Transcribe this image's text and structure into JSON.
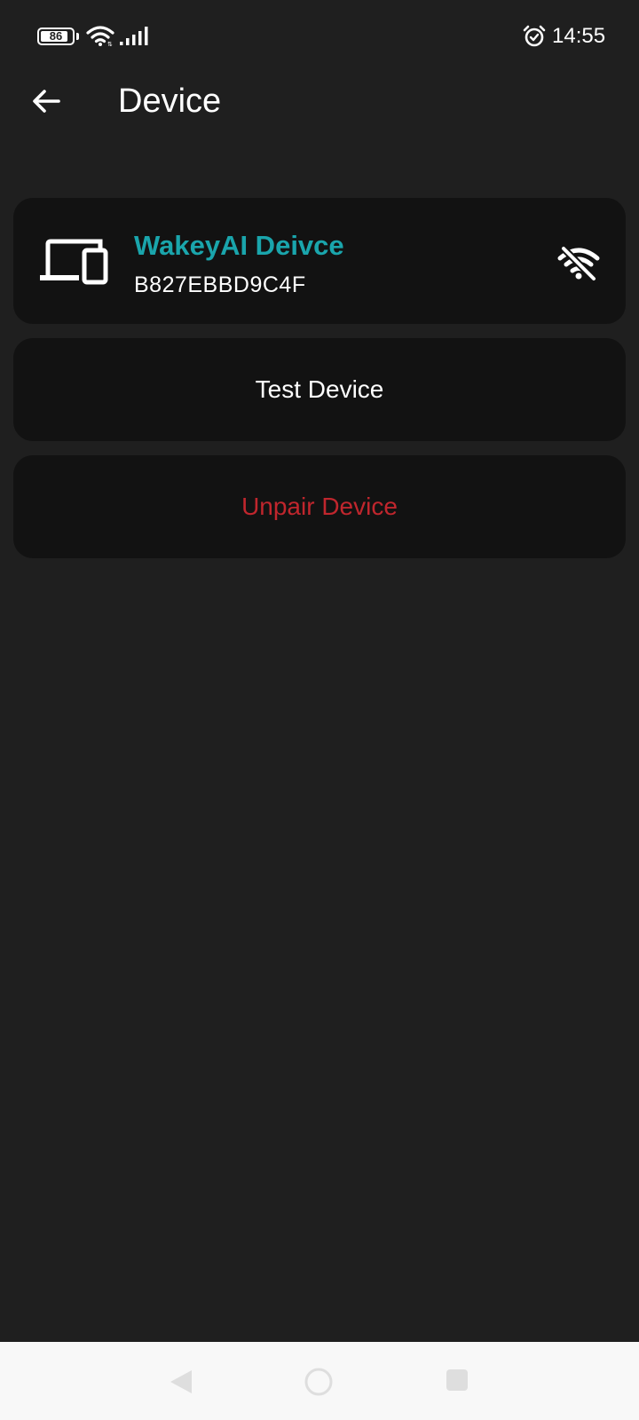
{
  "status_bar": {
    "battery_level": "86",
    "time": "14:55",
    "icons": [
      "battery-icon",
      "wifi-icon",
      "cellular-signal-icon",
      "alarm-icon"
    ]
  },
  "app_bar": {
    "title": "Device",
    "back_icon": "arrow-left-icon"
  },
  "device": {
    "name": "WakeyAI Deivce",
    "id": "B827EBBD9C4F",
    "icon": "devices-icon",
    "connection_icon": "wifi-off-icon"
  },
  "actions": {
    "test_label": "Test Device",
    "unpair_label": "Unpair Device"
  },
  "nav_bar": {
    "icons": [
      "nav-back-icon",
      "nav-home-icon",
      "nav-recents-icon"
    ]
  },
  "colors": {
    "background": "#1f1f1f",
    "card": "#121212",
    "accent": "#1aa5ac",
    "danger": "#c0262d",
    "nav_bar": "#f8f8f8"
  }
}
